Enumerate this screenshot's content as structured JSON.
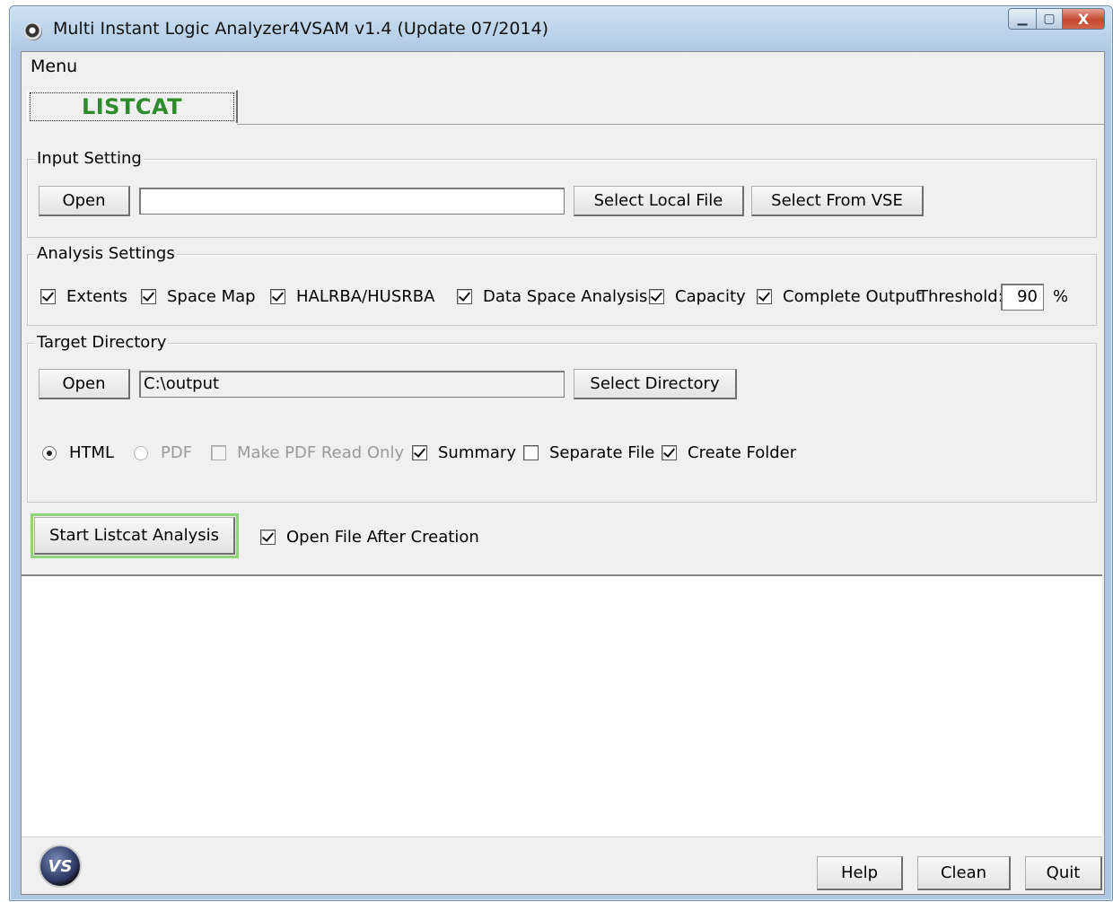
{
  "window": {
    "title": "Multi Instant Logic Analyzer4VSAM v1.4 (Update 07/2014)",
    "minimize_label": "▁",
    "maximize_label": "▢",
    "close_label": "X"
  },
  "menu": {
    "label": "Menu"
  },
  "tabs": [
    {
      "label": "LISTCAT",
      "color": "#2e8b2e"
    }
  ],
  "input_setting": {
    "title": "Input Setting",
    "open_label": "Open",
    "file_value": "",
    "select_local_label": "Select Local File",
    "select_vse_label": "Select From VSE"
  },
  "analysis_settings": {
    "title": "Analysis Settings",
    "options": [
      {
        "label": "Extents",
        "checked": true
      },
      {
        "label": "Space Map",
        "checked": true
      },
      {
        "label": "HALRBA/HUSRBA",
        "checked": true
      },
      {
        "label": "Data Space Analysis",
        "checked": true
      },
      {
        "label": "Capacity",
        "checked": true
      },
      {
        "label": "Complete Output",
        "checked": true
      }
    ],
    "threshold_label": "Threshold:",
    "threshold_value": "90",
    "threshold_unit": "%"
  },
  "target_directory": {
    "title": "Target Directory",
    "open_label": "Open",
    "path_value": "C:\\output",
    "select_dir_label": "Select Directory",
    "format_html": {
      "label": "HTML",
      "selected": true
    },
    "format_pdf": {
      "label": "PDF",
      "selected": false,
      "disabled": true
    },
    "make_pdf_readonly": {
      "label": "Make PDF Read Only",
      "checked": false,
      "disabled": true
    },
    "summary": {
      "label": "Summary",
      "checked": true
    },
    "separate_file": {
      "label": "Separate File",
      "checked": false
    },
    "create_folder": {
      "label": "Create Folder",
      "checked": true
    }
  },
  "actions": {
    "start_label": "Start Listcat Analysis",
    "open_after_label": "Open File After Creation",
    "open_after_checked": true
  },
  "footer": {
    "logo_text": "VS",
    "help_label": "Help",
    "clean_label": "Clean",
    "quit_label": "Quit"
  },
  "colors": {
    "accent_green": "#8fd47a",
    "titlebar": "#bcd3ea",
    "close_red": "#c6462e"
  }
}
